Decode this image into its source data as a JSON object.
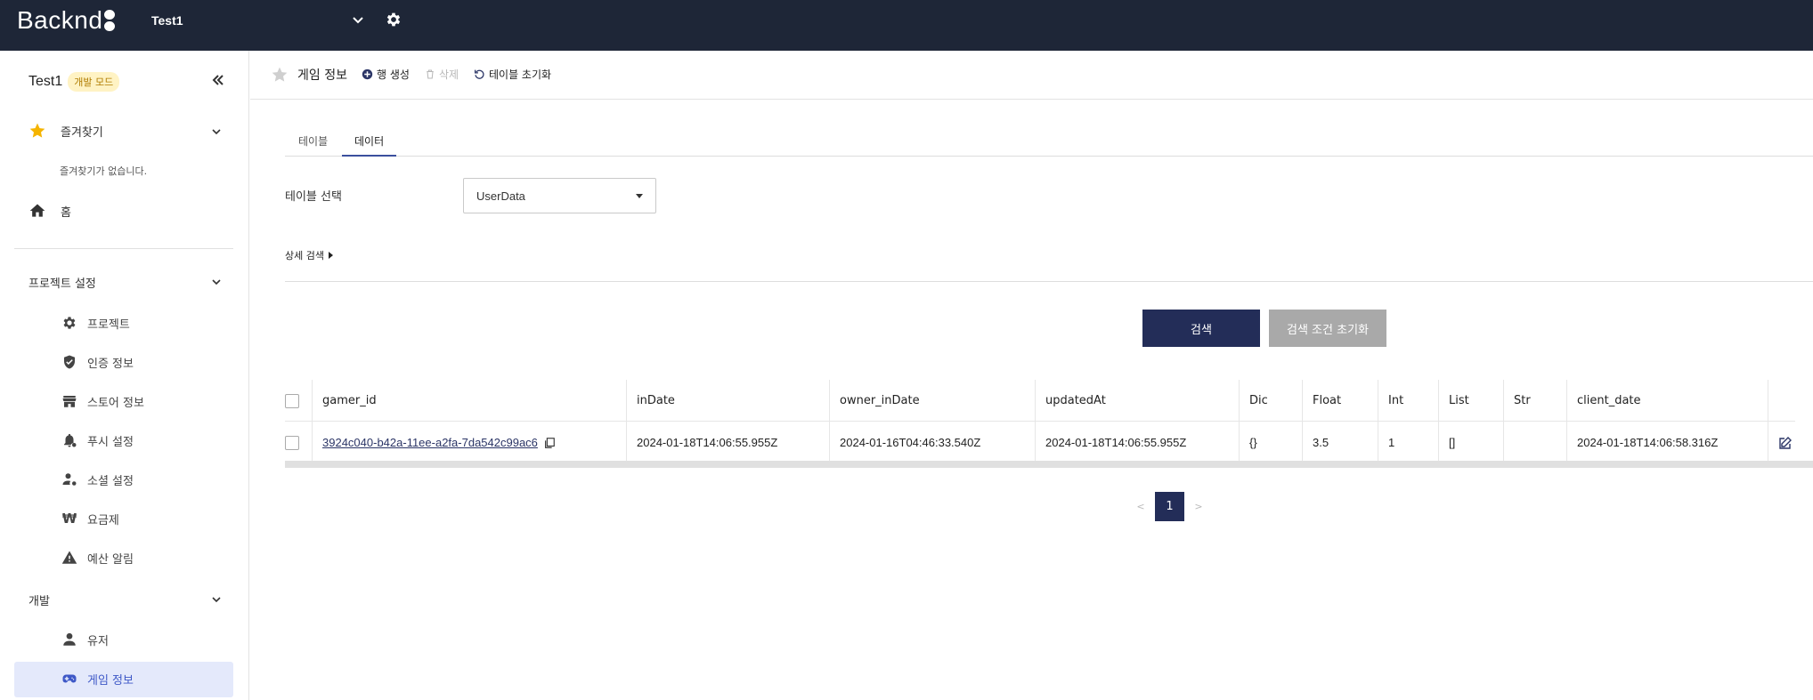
{
  "topbar": {
    "logo": "Backnd",
    "project_name": "Test1"
  },
  "sidebar": {
    "project_title": "Test1",
    "mode_badge": "개발 모드",
    "favorites": {
      "label": "즐겨찾기",
      "empty_text": "즐겨찾기가 없습니다."
    },
    "home": "홈",
    "project_settings": {
      "label": "프로젝트 설정",
      "items": [
        "프로젝트",
        "인증 정보",
        "스토어 정보",
        "푸시 설정",
        "소셜 설정",
        "요금제",
        "예산 알림"
      ]
    },
    "dev": {
      "label": "개발",
      "items": [
        "유저",
        "게임 정보"
      ],
      "active": "게임 정보"
    }
  },
  "header": {
    "title": "게임 정보",
    "actions": {
      "add_row": "행 생성",
      "delete": "삭제",
      "reset_table": "테이블 초기화"
    }
  },
  "tabs": {
    "table": "테이블",
    "data": "데이터",
    "active": "데이터"
  },
  "table_select": {
    "label": "테이블 선택",
    "value": "UserData"
  },
  "advanced_search": "상세 검색",
  "buttons": {
    "search": "검색",
    "reset_conditions": "검색 조건 초기화"
  },
  "data_table": {
    "columns": [
      "gamer_id",
      "inDate",
      "owner_inDate",
      "updatedAt",
      "Dic",
      "Float",
      "Int",
      "List",
      "Str",
      "client_date"
    ],
    "rows": [
      {
        "gamer_id": "3924c040-b42a-11ee-a2fa-7da542c99ac6",
        "inDate": "2024-01-18T14:06:55.955Z",
        "owner_inDate": "2024-01-16T04:46:33.540Z",
        "updatedAt": "2024-01-18T14:06:55.955Z",
        "Dic": "{}",
        "Float": "3.5",
        "Int": "1",
        "List": "[]",
        "Str": "",
        "client_date": "2024-01-18T14:06:58.316Z"
      }
    ]
  },
  "pagination": {
    "prev": "<",
    "current": "1",
    "next": ">"
  },
  "colors": {
    "topbar": "#1e2637",
    "primary": "#232d58",
    "active_bg": "#e4e9fb",
    "accent_star": "#f5b400"
  }
}
